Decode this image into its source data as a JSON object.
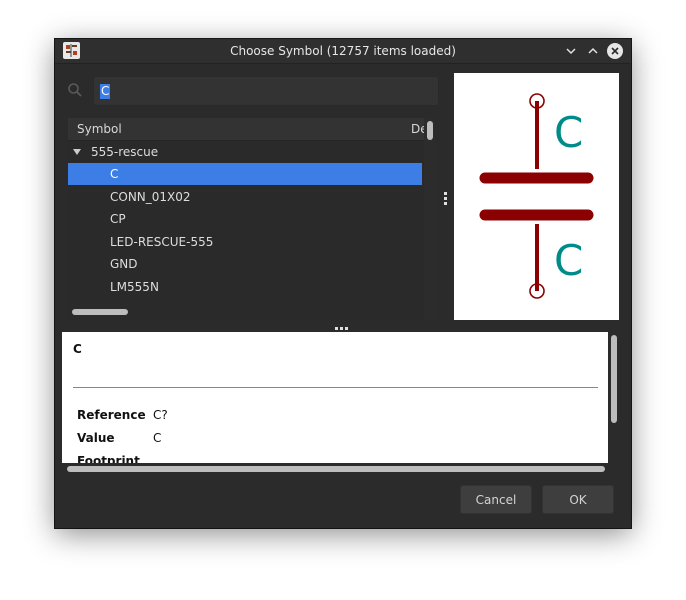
{
  "window": {
    "title": "Choose Symbol (12757 items loaded)"
  },
  "search": {
    "value": "C",
    "icon": "search-icon"
  },
  "tree": {
    "columns": [
      "Symbol",
      "De"
    ],
    "group": "555-rescue",
    "items": [
      "C",
      "CONN_01X02",
      "CP",
      "LED-RESCUE-555",
      "GND",
      "LM555N"
    ],
    "selected": "C"
  },
  "preview": {
    "labels": [
      "C",
      "C"
    ],
    "colors": {
      "body": "#8b0000",
      "text": "#008b8b"
    }
  },
  "details": {
    "name": "C",
    "fields": [
      {
        "key": "Reference",
        "value": "C?"
      },
      {
        "key": "Value",
        "value": "C"
      },
      {
        "key": "Footprint",
        "value": ""
      }
    ]
  },
  "buttons": {
    "cancel": "Cancel",
    "ok": "OK"
  },
  "colors": {
    "selection": "#3d7ee6",
    "dialog_bg": "#2b2b2b"
  }
}
